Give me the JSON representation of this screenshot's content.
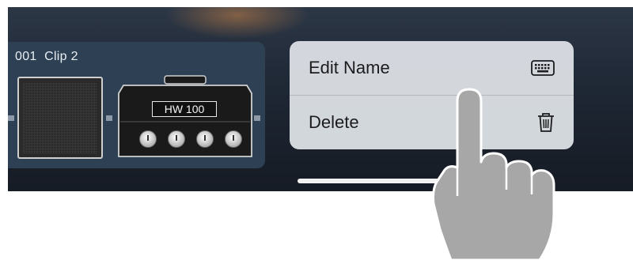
{
  "preset": {
    "title": "001  Clip 2",
    "amp_name": "HW 100"
  },
  "context_menu": {
    "items": [
      {
        "label": "Edit Name",
        "icon": "keyboard-icon"
      },
      {
        "label": "Delete",
        "icon": "trash-icon"
      }
    ]
  },
  "colors": {
    "screen_bg": "#1e2734",
    "card_bg": "#2d4054",
    "menu_bg": "#d9dde2",
    "hand": "#a7a7a7"
  }
}
